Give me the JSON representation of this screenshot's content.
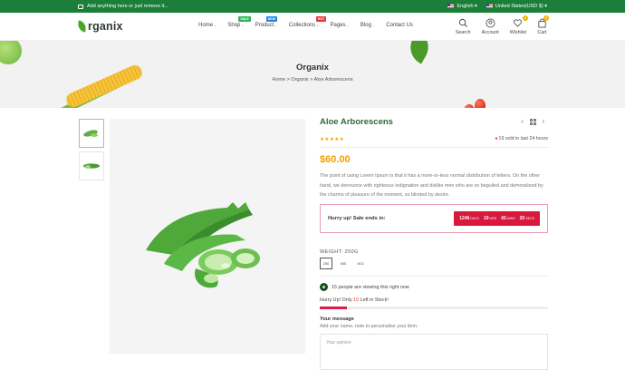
{
  "topbar": {
    "announcement": "Add anything here or just remove it...",
    "language": "English",
    "currency": "United States(USD $)"
  },
  "header": {
    "logo_text": "rganix",
    "nav": [
      {
        "label": "Home",
        "chevron": true
      },
      {
        "label": "Shop",
        "chevron": true,
        "badge": "SALE",
        "badge_color": "#2fb45a"
      },
      {
        "label": "Product",
        "chevron": true,
        "badge": "NEW",
        "badge_color": "#1e88e5"
      },
      {
        "label": "Collections",
        "chevron": true,
        "badge": "HOT",
        "badge_color": "#e53935"
      },
      {
        "label": "Pages",
        "chevron": true
      },
      {
        "label": "Blog",
        "chevron": true
      },
      {
        "label": "Contact Us",
        "chevron": false
      }
    ],
    "icons": {
      "search": "Search",
      "account": "Account",
      "wishlist": "Wishlist",
      "wishlist_count": "0",
      "cart": "Cart",
      "cart_count": "0"
    }
  },
  "banner": {
    "title": "Organix",
    "breadcrumb": [
      "Home",
      "Organix",
      "Aloe Arborescens"
    ],
    "separator": ">"
  },
  "product": {
    "title": "Aloe Arborescens",
    "rating_stars": "★★★★★",
    "sold_text": "19 sold in last 24 hours",
    "price": "$60.00",
    "description": "The point of using Lorem Ipsum is that it has a more-or-less normal distribution of letters. On the other hand, we denounce with righteous indignation and dislike men who are so beguiled and demoralized by the charms of pleasure of the moment, so blinded by desire.",
    "hurry_label": "Hurry up! Sale ends in:",
    "timer": {
      "days": "1246",
      "days_label": "DAYS",
      "hrs": "19",
      "hrs_label": "HRS",
      "mins": "43",
      "mins_label": "MINS",
      "secs": "20",
      "secs_label": "SECS"
    },
    "weight_label": "WEIGHT: 250G",
    "weights": [
      "250",
      "500",
      "1KG"
    ],
    "viewing_text": "15 people are viewing this right now",
    "stock_prefix": "Hurry Up! Only ",
    "stock_count": "10",
    "stock_suffix": " Left in Stock!",
    "stock_fill_fraction": 0.12,
    "message_label": "Your message",
    "message_sub": "Add your name, note to personalise your item.",
    "opinion_placeholder": "Your opinion"
  },
  "colors": {
    "topbar": "#1b7f3a",
    "accent_price": "#f0a000",
    "timer": "#d9183b",
    "title": "#2d6a3a"
  }
}
